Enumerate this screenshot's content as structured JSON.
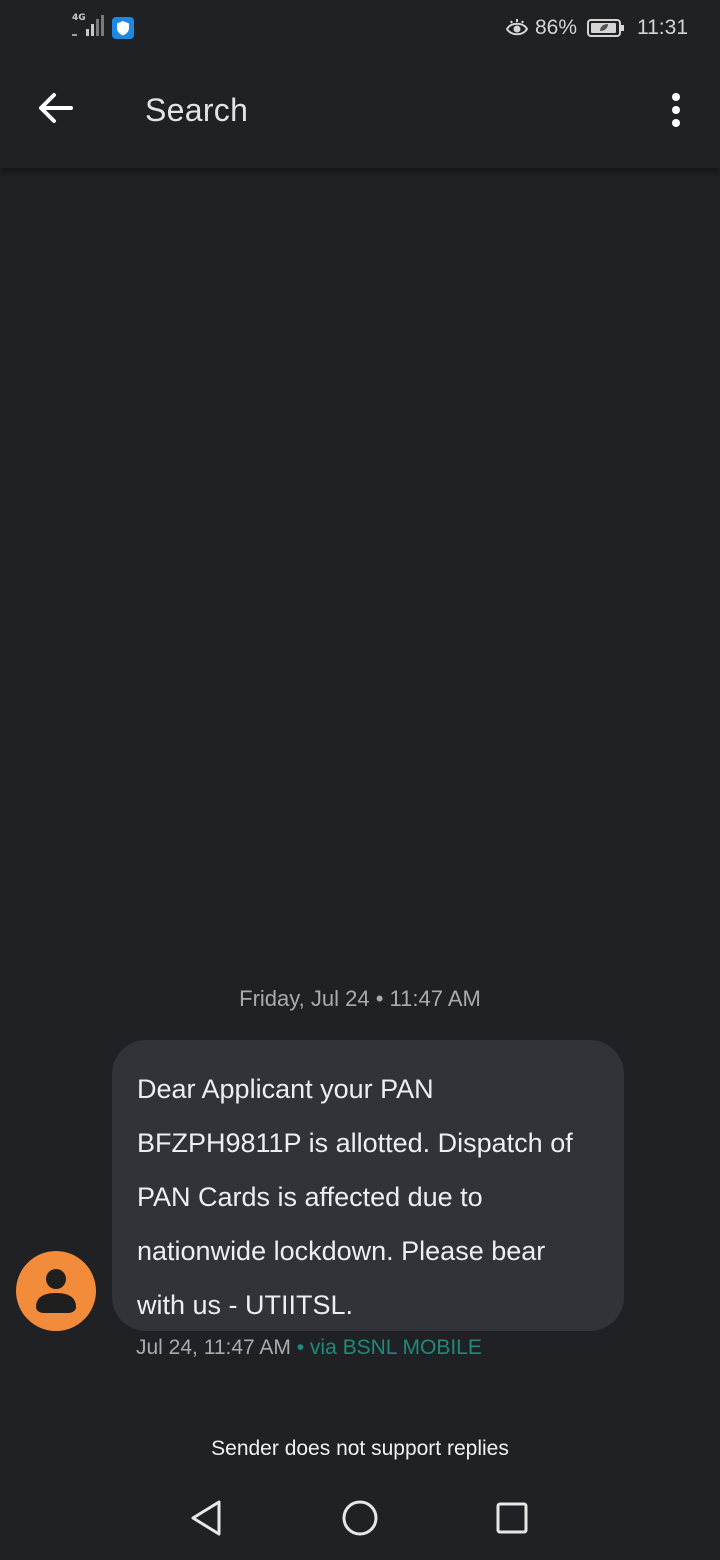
{
  "status_bar": {
    "network_type": "4G",
    "battery_percent": "86%",
    "time": "11:31"
  },
  "app_bar": {
    "search_label": "Search"
  },
  "conversation": {
    "date_header": "Friday, Jul 24 • 11:47 AM",
    "message": {
      "text": "Dear Applicant your PAN BFZPH9811P is allotted. Dispatch of PAN Cards is affected due to nationwide lockdown. Please bear with us - UTIITSL.",
      "timestamp": "Jul 24, 11:47 AM",
      "separator": " • ",
      "via": "via BSNL MOBILE"
    },
    "reply_notice": "Sender does not support replies"
  },
  "colors": {
    "background": "#202125",
    "bubble": "#323338",
    "avatar": "#f28c3a",
    "via_accent": "#1e8a78"
  }
}
